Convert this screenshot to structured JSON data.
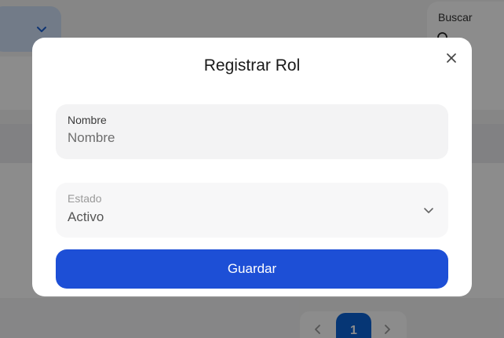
{
  "background": {
    "search_label": "Buscar",
    "pagination_current": "1"
  },
  "modal": {
    "title": "Registrar Rol",
    "name_field": {
      "label": "Nombre",
      "placeholder": "Nombre",
      "value": ""
    },
    "status_field": {
      "label": "Estado",
      "value": "Activo"
    },
    "save_label": "Guardar"
  },
  "icons": {
    "close": "close-icon",
    "select_chevron": "chevron-down-icon",
    "search": "search-icon",
    "prev": "chevron-left-icon",
    "next": "chevron-right-icon"
  },
  "colors": {
    "primary_button": "#1d4fd6",
    "active_page": "#0c63d6",
    "overlay": "rgba(0,0,0,0.45)"
  }
}
